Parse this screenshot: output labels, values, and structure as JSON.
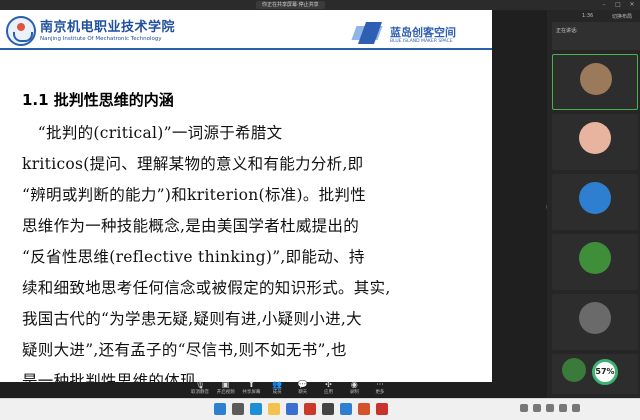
{
  "meeting": {
    "share_tag": "你正在共享屏幕·停止共享"
  },
  "slide": {
    "school_name": "南京机电职业技术学院",
    "school_name_en": "Nanjing Institute Of Mechatronic Technology",
    "space_name": "蓝岛创客空间",
    "space_name_en": "BLUE ISLAND MAKER SPACE",
    "section_title": "1.1 批判性思维的内涵",
    "lines": [
      "　“批判的(critical)”一词源于希腊文",
      "kriticos(提问、理解某物的意义和有能力分析,即",
      "“辨明或判断的能力”)和kriterion(标准)。批判性",
      "思维作为一种技能概念,是由美国学者杜威提出的",
      "“反省性思维(reflective thinking)”,即能动、持",
      "续和细致地思考任何信念或被假定的知识形式。其实,",
      "我国古代的“为学患无疑,疑则有进,小疑则小进,大",
      "疑则大进”,还有孟子的“尽信书,则不如无书”,也",
      "是一种批判性思维的体现。"
    ]
  },
  "toolbar": [
    {
      "name": "mute",
      "icon": "mic-icon",
      "label": "取消静音"
    },
    {
      "name": "video",
      "icon": "camera-icon",
      "label": "开启视频"
    },
    {
      "name": "share",
      "icon": "share-screen-icon",
      "label": "共享屏幕"
    },
    {
      "name": "members",
      "icon": "members-icon",
      "label": "成员"
    },
    {
      "name": "chat",
      "icon": "chat-icon",
      "label": "聊天"
    },
    {
      "name": "apps",
      "icon": "apps-icon",
      "label": "应用"
    },
    {
      "name": "record",
      "icon": "record-icon",
      "label": "录制"
    },
    {
      "name": "more",
      "icon": "more-icon",
      "label": "更多"
    }
  ],
  "pane": {
    "time": "1:36",
    "layout_label": "切换布局",
    "header": "正在讲话:",
    "tiles": [
      {
        "name": "",
        "avatar": "#9a7a5a"
      },
      {
        "name": "",
        "avatar": "#e8b4a0"
      },
      {
        "name": "",
        "avatar": "#2f7fd1"
      },
      {
        "name": "",
        "avatar": "#3f8f3a"
      },
      {
        "name": "",
        "avatar": "#6a6a6a"
      },
      {
        "name": "",
        "avatar": "#3a7a3a"
      }
    ],
    "cpu_percent": "57%"
  },
  "taskbar": {
    "clock_time": "",
    "clock_date": ""
  },
  "colors": {
    "brand_blue": "#1f4fa0",
    "active_green": "#4caf50"
  }
}
